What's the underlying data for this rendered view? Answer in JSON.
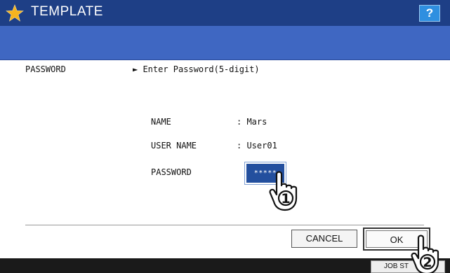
{
  "title": {
    "text": "TEMPLATE",
    "star_icon": "star-icon",
    "help_label": "?"
  },
  "header_row": {
    "field_label": "PASSWORD",
    "instruction": "► Enter Password(5-digit)"
  },
  "details": {
    "name_label": "NAME",
    "name_value": ": Mars",
    "user_name_label": "USER NAME",
    "user_name_value": ": User01",
    "password_label": "PASSWORD",
    "password_value": "*****"
  },
  "buttons": {
    "cancel": "CANCEL",
    "ok": "OK"
  },
  "bottom_bar": {
    "job_status": "JOB ST"
  },
  "callouts": {
    "step1": "1",
    "step2": "2"
  },
  "colors": {
    "title_bar": "#1e3f86",
    "band": "#3f67c2",
    "field": "#234f9e",
    "help": "#2f8fe0",
    "star": "#f5b31f"
  }
}
